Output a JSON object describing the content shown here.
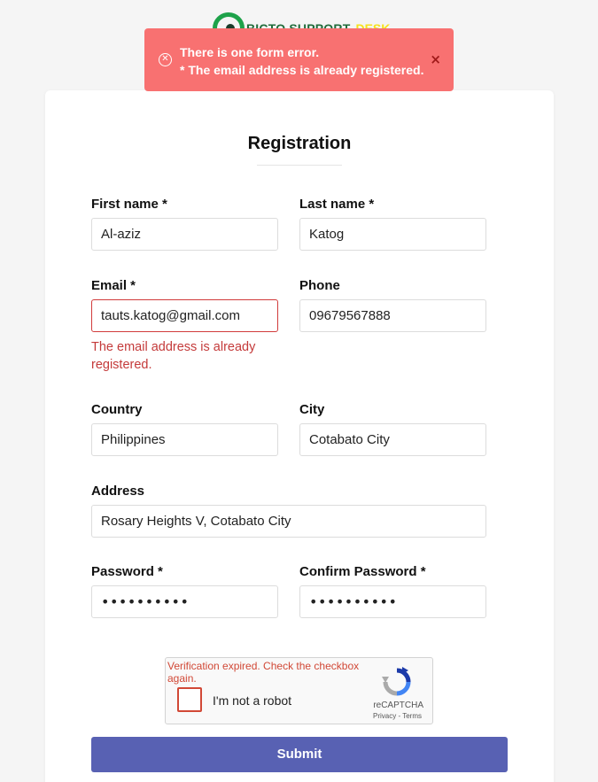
{
  "brand": {
    "name_part1": "BICTO SUPPORT",
    "name_part2": "DESK"
  },
  "toast": {
    "line1": "There is one form error.",
    "line2": "* The email address is already registered.",
    "close_label": "×",
    "icon": "error-circle-icon",
    "color": "#f87171"
  },
  "form": {
    "title": "Registration",
    "fields": {
      "first_name": {
        "label": "First name *",
        "value": "Al-aziz"
      },
      "last_name": {
        "label": "Last name *",
        "value": "Katog"
      },
      "email": {
        "label": "Email *",
        "value": "tauts.katog@gmail.com",
        "error": "The email address is already registered."
      },
      "phone": {
        "label": "Phone",
        "value": "09679567888"
      },
      "country": {
        "label": "Country",
        "value": "Philippines"
      },
      "city": {
        "label": "City",
        "value": "Cotabato City"
      },
      "address": {
        "label": "Address",
        "value": "Rosary Heights V, Cotabato City"
      },
      "password": {
        "label": "Password *",
        "value": "••••••••••"
      },
      "confirm_password": {
        "label": "Confirm Password *",
        "value": "••••••••••"
      }
    },
    "captcha": {
      "message": "Verification expired. Check the checkbox again.",
      "label": "I'm not a robot",
      "brand": "reCAPTCHA",
      "links": "Privacy - Terms"
    },
    "submit_label": "Submit",
    "accent_color": "#5861b3",
    "error_color": "#c43a3a"
  }
}
